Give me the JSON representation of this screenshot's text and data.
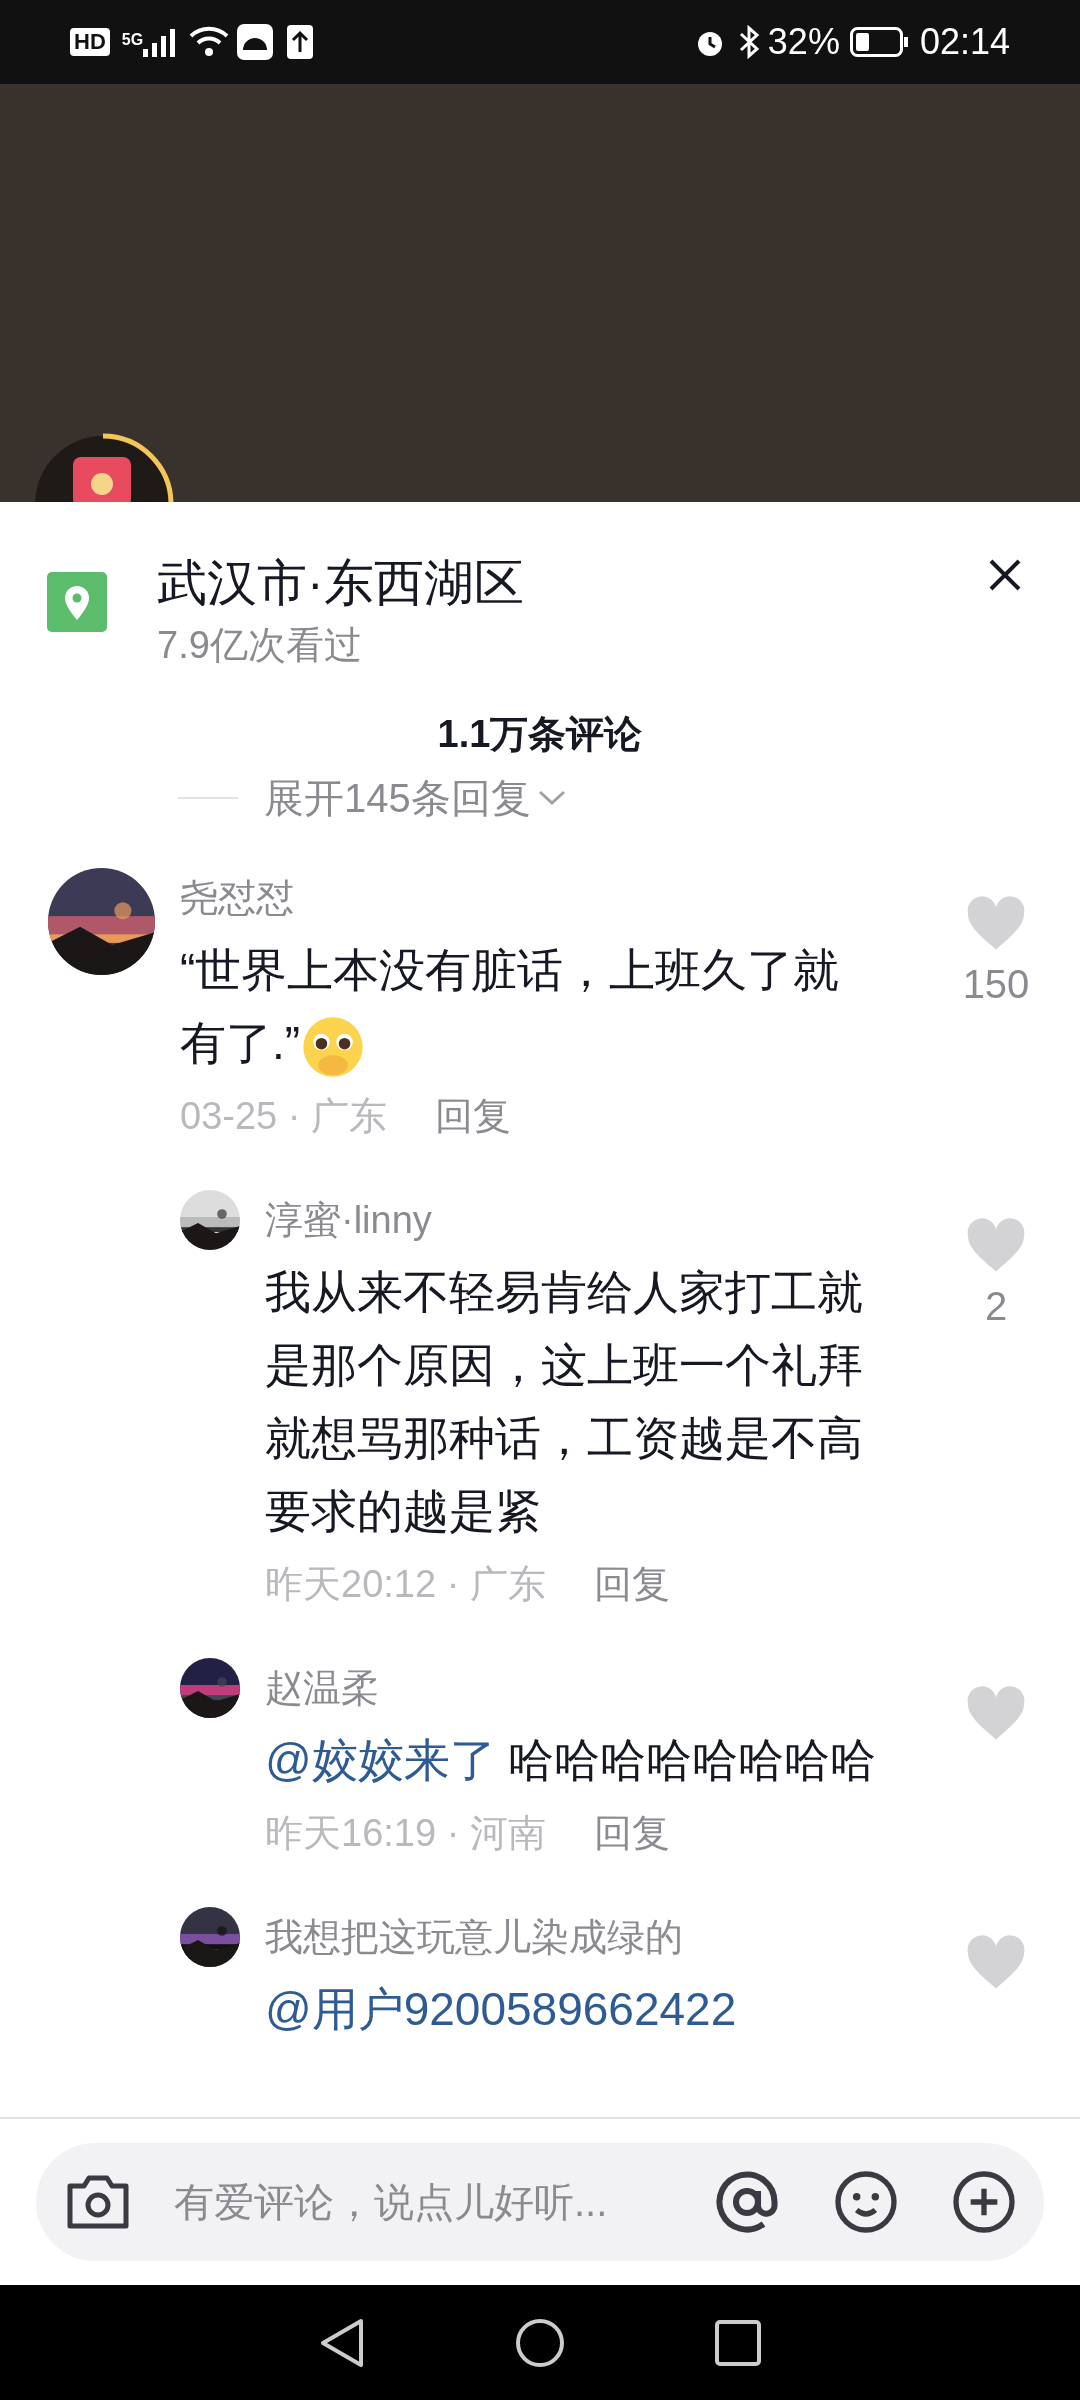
{
  "status_bar": {
    "left": [
      "HD",
      "5G"
    ],
    "battery": "32%",
    "time": "02:14"
  },
  "location": {
    "title": "武汉市·东西湖区",
    "views": "7.9亿次看过"
  },
  "comments_header": {
    "count": "1.1万条评论",
    "expand": "展开145条回复"
  },
  "comments": [
    {
      "user": "尧怼怼",
      "segments": [
        {
          "kind": "text",
          "text": "“世界上本没有脏话，上班久了就有了.”"
        },
        {
          "kind": "emoji"
        }
      ],
      "time": "03-25 · 广东",
      "reply": "回复",
      "liked": false,
      "likes": "150",
      "replies": [
        {
          "user": "淳蜜·linny",
          "segments": [
            {
              "kind": "text",
              "text": "我从来不轻易肯给人家打工就是那个原因，这上班一个礼拜就想骂那种话，工资越是不高要求的越是紧"
            }
          ],
          "time": "昨天20:12 · 广东",
          "reply": "回复",
          "liked": false,
          "likes": "2"
        },
        {
          "user": "赵温柔",
          "segments": [
            {
              "kind": "mention",
              "text": "@姣姣来了"
            },
            {
              "kind": "text",
              "text": " 哈哈哈哈哈哈哈哈"
            }
          ],
          "time": "昨天16:19 · 河南",
          "reply": "回复",
          "liked": false
        },
        {
          "user": "我想把这玩意儿染成绿的",
          "segments": [
            {
              "kind": "mention",
              "text": "@用户9200589662422"
            }
          ],
          "liked": false
        }
      ]
    }
  ],
  "input": {
    "placeholder": "有爱评论，说点儿好听..."
  }
}
